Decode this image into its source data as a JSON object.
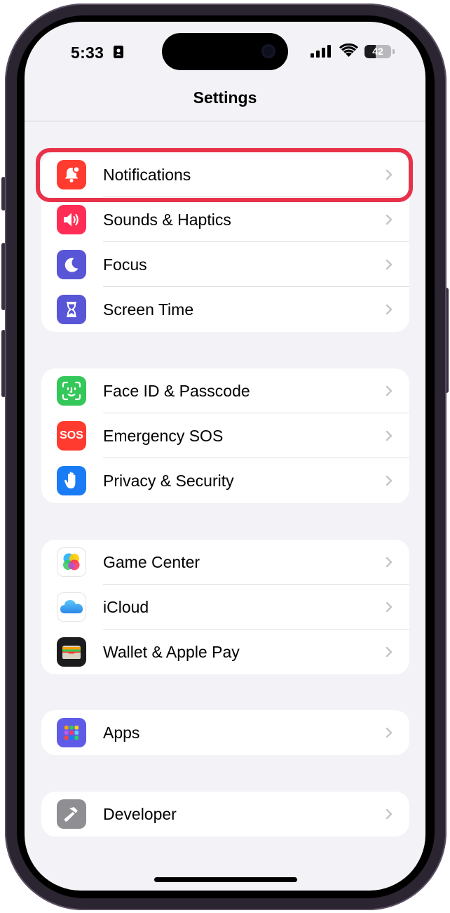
{
  "status_bar": {
    "time": "5:33",
    "battery": "42"
  },
  "nav": {
    "title": "Settings"
  },
  "groups": [
    {
      "items": [
        {
          "label": "Notifications",
          "icon": "bell-icon",
          "color": "#ff3b30"
        },
        {
          "label": "Sounds & Haptics",
          "icon": "speaker-icon",
          "color": "#ff2d55"
        },
        {
          "label": "Focus",
          "icon": "moon-icon",
          "color": "#5856d6"
        },
        {
          "label": "Screen Time",
          "icon": "hourglass-icon",
          "color": "#5856d6"
        }
      ]
    },
    {
      "items": [
        {
          "label": "Face ID & Passcode",
          "icon": "face-id-icon",
          "color": "#34c759"
        },
        {
          "label": "Emergency SOS",
          "icon": "sos-icon",
          "icon_text": "SOS",
          "color": "#ff3b30"
        },
        {
          "label": "Privacy & Security",
          "icon": "hand-icon",
          "color": "#1a7cf5"
        }
      ]
    },
    {
      "items": [
        {
          "label": "Game Center",
          "icon": "game-center-icon",
          "color": "#ffffff"
        },
        {
          "label": "iCloud",
          "icon": "cloud-icon",
          "color": "#ffffff"
        },
        {
          "label": "Wallet & Apple Pay",
          "icon": "wallet-icon",
          "color": "#1c1c1e"
        }
      ]
    },
    {
      "items": [
        {
          "label": "Apps",
          "icon": "apps-grid-icon",
          "color": "#5e5ce6"
        }
      ]
    },
    {
      "items": [
        {
          "label": "Developer",
          "icon": "hammer-icon",
          "color": "#8e8e93"
        }
      ]
    }
  ],
  "highlight_color": "#e8324a"
}
